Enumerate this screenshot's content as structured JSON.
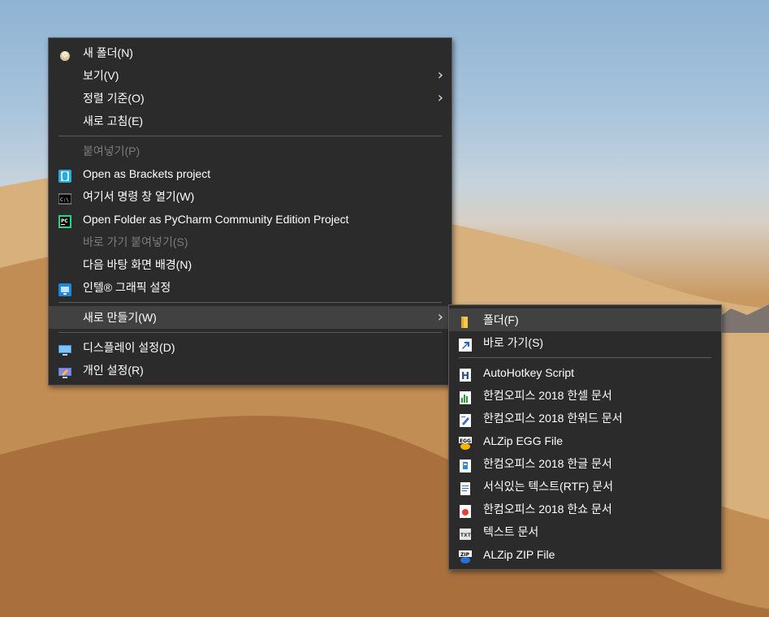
{
  "context_menu": {
    "items": [
      {
        "label": "새 폴더(N)",
        "icon": "new-folder-icon"
      },
      {
        "label": "보기(V)",
        "submenu": true
      },
      {
        "label": "정렬 기준(O)",
        "submenu": true
      },
      {
        "label": "새로 고침(E)"
      },
      {
        "label": "붙여넣기(P)",
        "disabled": true
      },
      {
        "label": "Open as Brackets project",
        "icon": "brackets-icon"
      },
      {
        "label": "여기서 명령 창 열기(W)",
        "icon": "command-prompt-icon"
      },
      {
        "label": "Open Folder as PyCharm Community Edition Project",
        "icon": "pycharm-icon"
      },
      {
        "label": "바로 가기 붙여넣기(S)",
        "disabled": true
      },
      {
        "label": "다음 바탕 화면 배경(N)"
      },
      {
        "label": "인텔® 그래픽 설정",
        "icon": "intel-graphics-icon"
      },
      {
        "label": "새로 만들기(W)",
        "submenu": true,
        "selected": true
      },
      {
        "label": "디스플레이 설정(D)",
        "icon": "display-icon"
      },
      {
        "label": "개인 설정(R)",
        "icon": "personalize-icon"
      }
    ]
  },
  "new_submenu": {
    "items": [
      {
        "label": "폴더(F)",
        "icon": "folder-icon",
        "selected": true
      },
      {
        "label": "바로 가기(S)",
        "icon": "shortcut-icon"
      },
      {
        "label": "AutoHotkey Script",
        "icon": "autohotkey-icon"
      },
      {
        "label": "한컴오피스 2018 한셀 문서",
        "icon": "hancell-icon"
      },
      {
        "label": "한컴오피스 2018 한워드 문서",
        "icon": "hanword-icon"
      },
      {
        "label": "ALZip EGG File",
        "icon": "alzip-egg-icon"
      },
      {
        "label": "한컴오피스 2018 한글 문서",
        "icon": "hangul-icon"
      },
      {
        "label": "서식있는 텍스트(RTF) 문서",
        "icon": "rtf-icon"
      },
      {
        "label": "한컴오피스 2018 한쇼 문서",
        "icon": "hanshow-icon"
      },
      {
        "label": "텍스트 문서",
        "icon": "text-document-icon"
      },
      {
        "label": "ALZip ZIP File",
        "icon": "alzip-zip-icon"
      }
    ]
  },
  "colors": {
    "menu_bg": "#2b2b2b",
    "hover_bg": "#414141",
    "text": "#ffffff",
    "disabled_text": "#7c7c7c",
    "separator": "#5c5c5c"
  }
}
